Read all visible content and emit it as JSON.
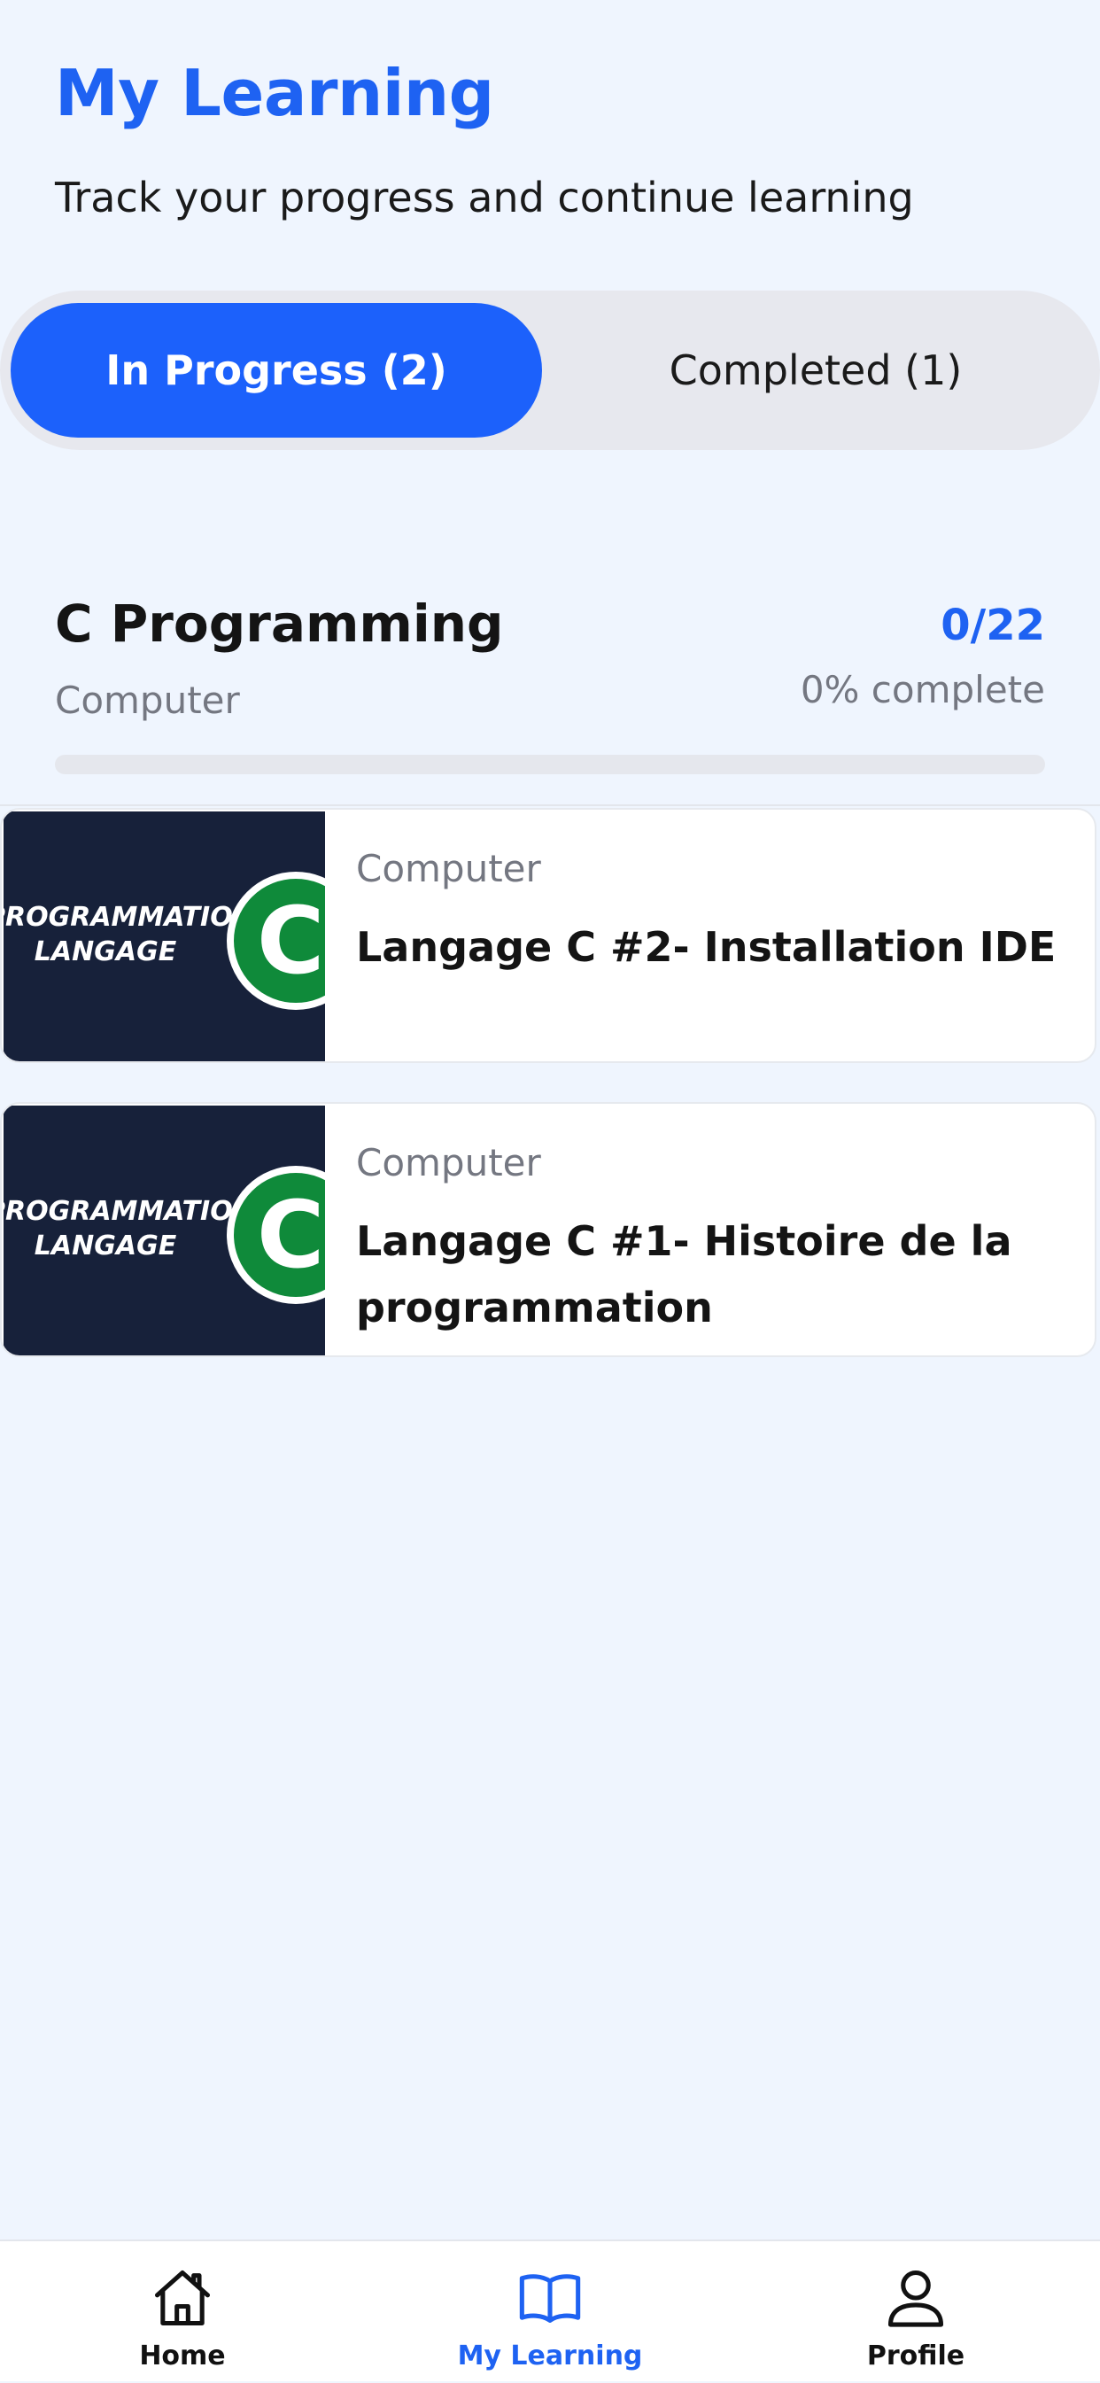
{
  "header": {
    "title": "My Learning",
    "subtitle": "Track your progress and continue learning"
  },
  "tabs": [
    {
      "label": "In Progress (2)",
      "active": true
    },
    {
      "label": "Completed (1)",
      "active": false
    }
  ],
  "course": {
    "title": "C Programming",
    "category": "Computer",
    "count": "0/22",
    "percent_label": "0% complete",
    "progress": 0
  },
  "lessons": [
    {
      "category": "Computer",
      "title": "Langage C #2-  Installation IDE",
      "thumbnail": {
        "line1": "PROGRAMMATION",
        "line2": "LANGAGE",
        "badge": "C"
      }
    },
    {
      "category": "Computer",
      "title": "Langage C #1-  Histoire de la programmation",
      "thumbnail": {
        "line1": "PROGRAMMATION",
        "line2": "LANGAGE",
        "badge": "C"
      }
    }
  ],
  "nav": [
    {
      "label": "Home",
      "icon": "home-icon",
      "active": false
    },
    {
      "label": "My Learning",
      "icon": "book-open-icon",
      "active": true
    },
    {
      "label": "Profile",
      "icon": "person-icon",
      "active": false
    }
  ],
  "colors": {
    "accent": "#1e62f2",
    "background": "#eff5fe",
    "thumbnail_bg": "#17213a",
    "badge_green": "#0f8a3a",
    "muted_text": "#747781"
  }
}
